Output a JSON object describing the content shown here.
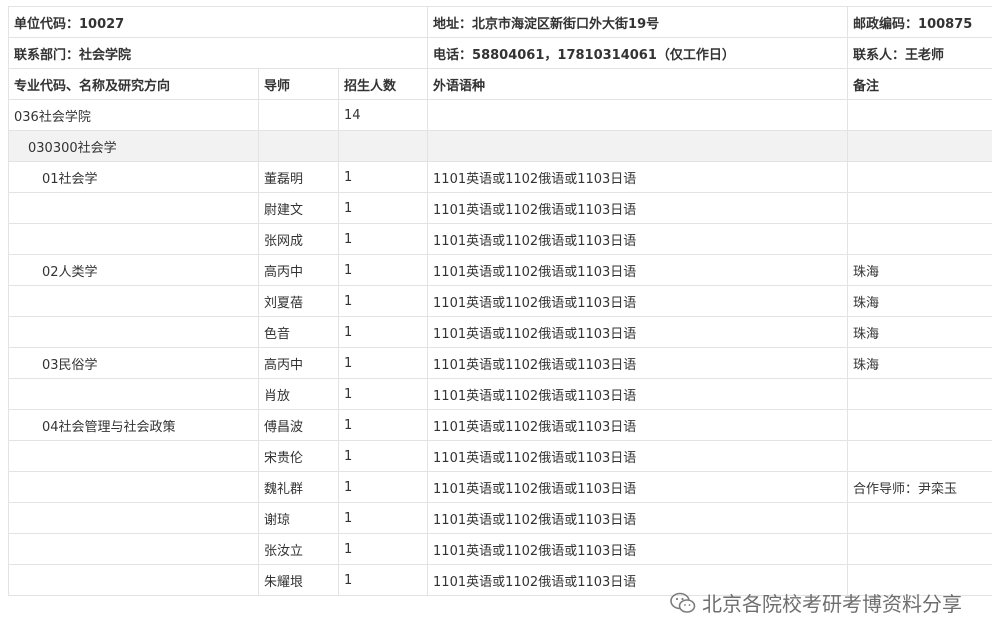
{
  "info": {
    "unit_code": "单位代码：10027",
    "address": "地址：北京市海淀区新街口外大街19号",
    "postcode": "邮政编码：100875",
    "department": "联系部门：社会学院",
    "phone": "电话：58804061，17810314061（仅工作日）",
    "contact": "联系人：王老师"
  },
  "headers": [
    "专业代码、名称及研究方向",
    "导师",
    "招生人数",
    "外语语种",
    "备注"
  ],
  "college": {
    "name": "036社会学院",
    "count": "14"
  },
  "major": {
    "name": "030300社会学"
  },
  "rows": [
    {
      "direction": "01社会学",
      "tutor": "董磊明",
      "count": "1",
      "lang": "1101英语或1102俄语或1103日语",
      "note": ""
    },
    {
      "direction": "",
      "tutor": "尉建文",
      "count": "1",
      "lang": "1101英语或1102俄语或1103日语",
      "note": ""
    },
    {
      "direction": "",
      "tutor": "张网成",
      "count": "1",
      "lang": "1101英语或1102俄语或1103日语",
      "note": ""
    },
    {
      "direction": "02人类学",
      "tutor": "高丙中",
      "count": "1",
      "lang": "1101英语或1102俄语或1103日语",
      "note": "珠海"
    },
    {
      "direction": "",
      "tutor": "刘夏蓓",
      "count": "1",
      "lang": "1101英语或1102俄语或1103日语",
      "note": "珠海"
    },
    {
      "direction": "",
      "tutor": "色音",
      "count": "1",
      "lang": "1101英语或1102俄语或1103日语",
      "note": "珠海"
    },
    {
      "direction": "03民俗学",
      "tutor": "高丙中",
      "count": "1",
      "lang": "1101英语或1102俄语或1103日语",
      "note": "珠海"
    },
    {
      "direction": "",
      "tutor": "肖放",
      "count": "1",
      "lang": "1101英语或1102俄语或1103日语",
      "note": ""
    },
    {
      "direction": "04社会管理与社会政策",
      "tutor": "傅昌波",
      "count": "1",
      "lang": "1101英语或1102俄语或1103日语",
      "note": ""
    },
    {
      "direction": "",
      "tutor": "宋贵伦",
      "count": "1",
      "lang": "1101英语或1102俄语或1103日语",
      "note": ""
    },
    {
      "direction": "",
      "tutor": "魏礼群",
      "count": "1",
      "lang": "1101英语或1102俄语或1103日语",
      "note": "合作导师：尹栾玉"
    },
    {
      "direction": "",
      "tutor": "谢琼",
      "count": "1",
      "lang": "1101英语或1102俄语或1103日语",
      "note": ""
    },
    {
      "direction": "",
      "tutor": "张汝立",
      "count": "1",
      "lang": "1101英语或1102俄语或1103日语",
      "note": ""
    },
    {
      "direction": "",
      "tutor": "朱耀垠",
      "count": "1",
      "lang": "1101英语或1102俄语或1103日语",
      "note": ""
    }
  ],
  "watermark": "北京各院校考研考博资料分享"
}
